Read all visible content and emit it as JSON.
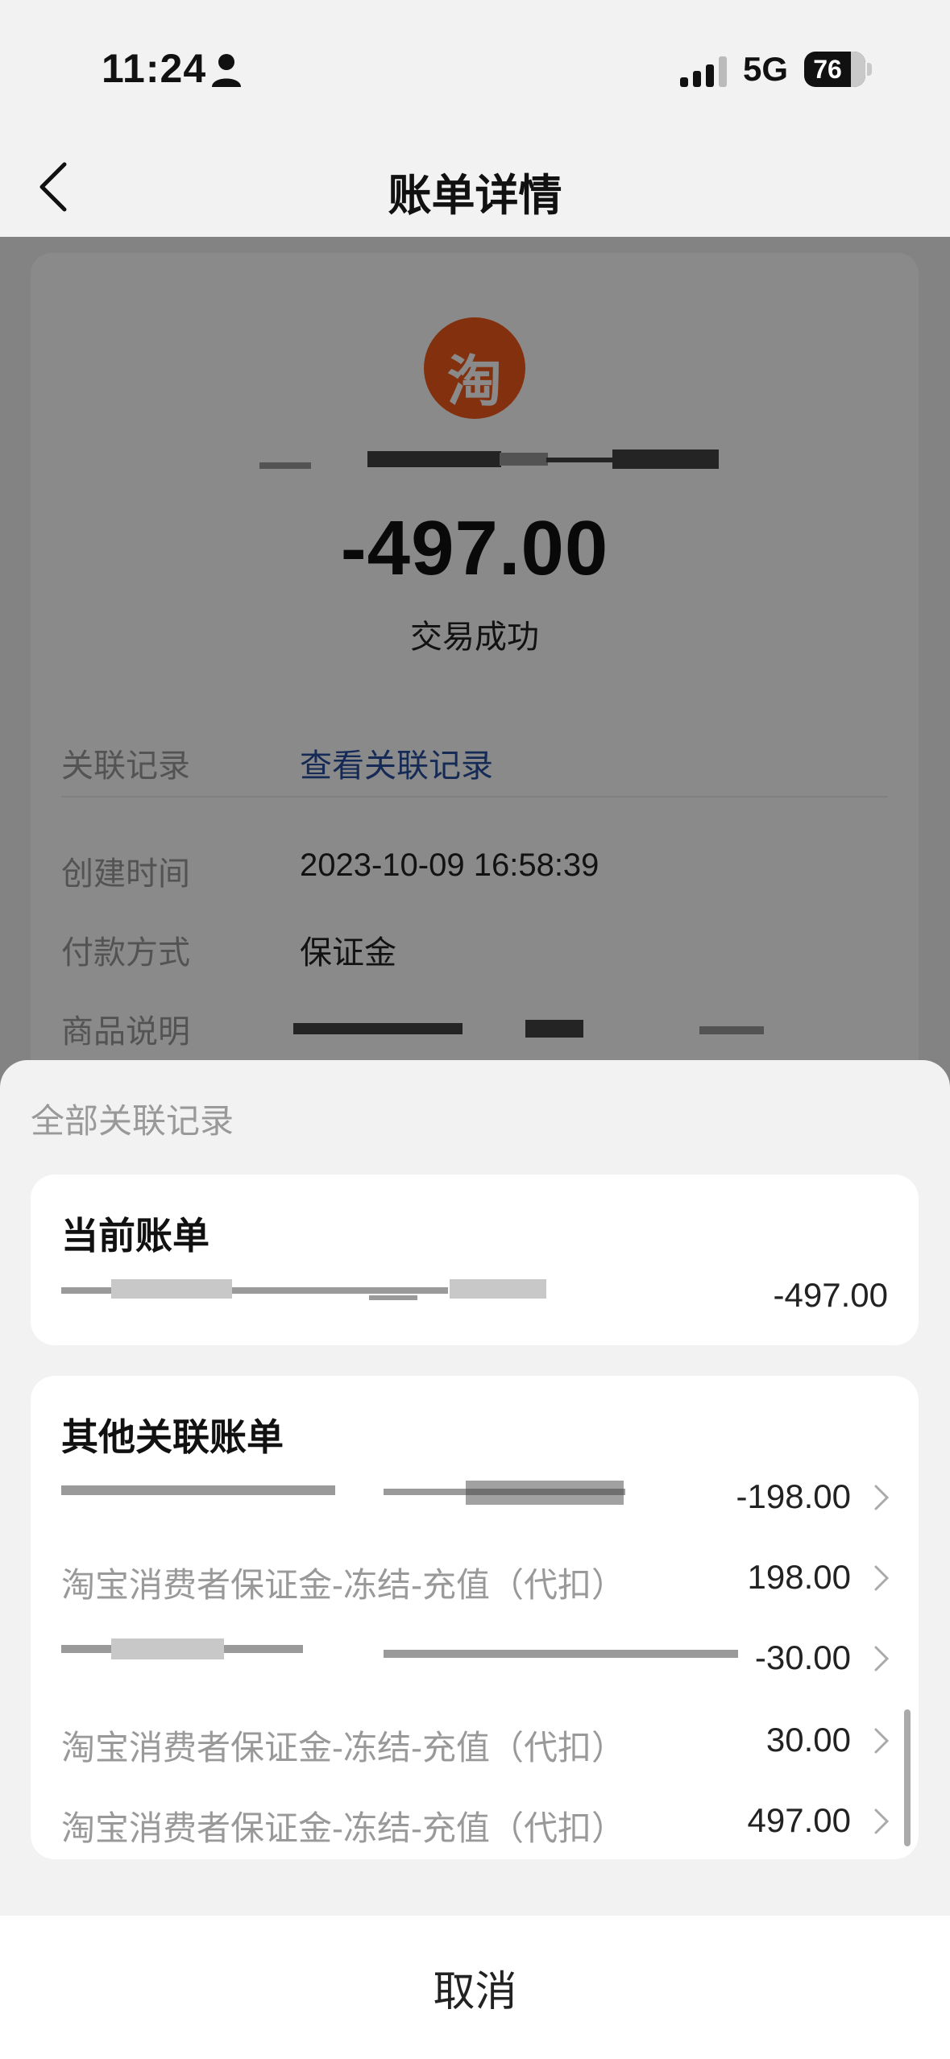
{
  "status_bar": {
    "time": "11:24",
    "network": "5G",
    "battery": "76"
  },
  "nav": {
    "title": "账单详情",
    "back_icon": "chevron-left-icon"
  },
  "detail": {
    "logo_char": "淘",
    "amount": "-497.00",
    "status": "交易成功",
    "rows": [
      {
        "label": "关联记录",
        "value": "查看关联记录"
      },
      {
        "label": "创建时间",
        "value": "2023-10-09 16:58:39"
      },
      {
        "label": "付款方式",
        "value": "保证金"
      },
      {
        "label": "商品说明",
        "value": "赔"
      }
    ]
  },
  "sheet": {
    "title": "全部关联记录",
    "current": {
      "title": "当前账单",
      "amount": "-497.00"
    },
    "other": {
      "title": "其他关联账单",
      "items": [
        {
          "name": "",
          "amount": "-198.00"
        },
        {
          "name": "淘宝消费者保证金-冻结-充值（代扣）",
          "amount": "198.00"
        },
        {
          "name": "",
          "amount": "-30.00"
        },
        {
          "name": "淘宝消费者保证金-冻结-充值（代扣）",
          "amount": "30.00"
        },
        {
          "name": "淘宝消费者保证金-冻结-充值（代扣）",
          "amount": "497.00"
        }
      ]
    },
    "cancel": "取消"
  }
}
